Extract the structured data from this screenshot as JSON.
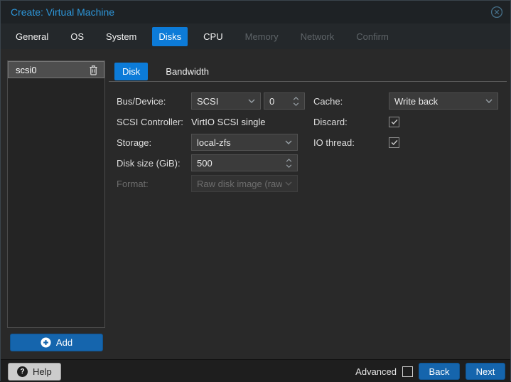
{
  "window": {
    "title": "Create: Virtual Machine"
  },
  "colors": {
    "accent_tab_blue": "#0c7bd8",
    "button_blue": "#1565ad",
    "title_blue": "#2d96d9",
    "field_bg": "#3b3b3b"
  },
  "tabs": {
    "items": [
      {
        "label": "General",
        "state": "normal"
      },
      {
        "label": "OS",
        "state": "normal"
      },
      {
        "label": "System",
        "state": "normal"
      },
      {
        "label": "Disks",
        "state": "active"
      },
      {
        "label": "CPU",
        "state": "normal"
      },
      {
        "label": "Memory",
        "state": "disabled"
      },
      {
        "label": "Network",
        "state": "disabled"
      },
      {
        "label": "Confirm",
        "state": "disabled"
      }
    ]
  },
  "disk_panel": {
    "items": [
      {
        "label": "scsi0",
        "state": "selected"
      }
    ],
    "add_label": "Add"
  },
  "subtabs": {
    "items": [
      {
        "label": "Disk",
        "state": "active"
      },
      {
        "label": "Bandwidth",
        "state": "normal"
      }
    ]
  },
  "form": {
    "bus_device": {
      "label": "Bus/Device:",
      "value": "SCSI",
      "number": "0"
    },
    "scsi_controller": {
      "label": "SCSI Controller:",
      "value": "VirtIO SCSI single"
    },
    "storage": {
      "label": "Storage:",
      "value": "local-zfs"
    },
    "disk_size": {
      "label": "Disk size (GiB):",
      "value": "500"
    },
    "format": {
      "label": "Format:",
      "value": "Raw disk image (raw",
      "state": "disabled"
    },
    "cache": {
      "label": "Cache:",
      "value": "Write back"
    },
    "discard": {
      "label": "Discard:",
      "state": "checked"
    },
    "io_thread": {
      "label": "IO thread:",
      "state": "checked"
    }
  },
  "footer": {
    "help_label": "Help",
    "advanced_label": "Advanced",
    "advanced_state": "unchecked",
    "back_label": "Back",
    "next_label": "Next"
  }
}
